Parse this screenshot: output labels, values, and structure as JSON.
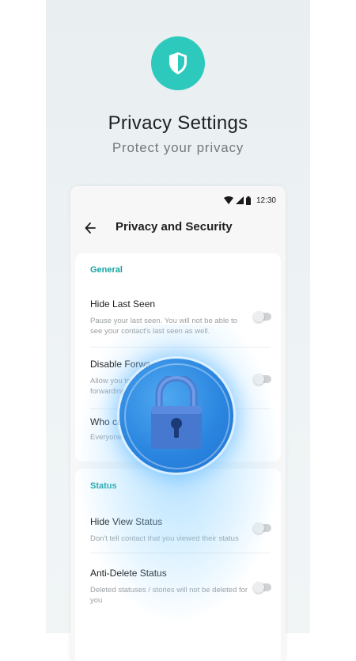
{
  "promo": {
    "title": "Privacy Settings",
    "subtitle": "Protect your privacy",
    "icon": "shield-icon",
    "accent_color": "#2ec9bd"
  },
  "status_bar": {
    "time": "12:30",
    "icons": [
      "wifi-icon",
      "signal-icon",
      "battery-icon"
    ]
  },
  "header": {
    "title": "Privacy and Security",
    "back_icon": "back-arrow-icon"
  },
  "sections": {
    "general": {
      "label": "General",
      "items": [
        {
          "title": "Hide Last Seen",
          "description": "Pause your last seen. You will not be able to see your contact's last seen as well.",
          "toggle_on": false
        },
        {
          "title": "Disable Forwa",
          "description": "Allow you to forwarding",
          "toggle_on": false
        },
        {
          "title": "Who car",
          "description": "Everyone"
        }
      ]
    },
    "status": {
      "label": "Status",
      "items": [
        {
          "title": "Hide View Status",
          "description": "Don't tell contact that you viewed their status",
          "toggle_on": false
        },
        {
          "title": "Anti-Delete Status",
          "description": "Deleted statuses / stories will not be deleted for you",
          "toggle_on": false
        }
      ]
    }
  },
  "overlay": {
    "icon": "padlock-icon",
    "color": "#2b86e0"
  }
}
